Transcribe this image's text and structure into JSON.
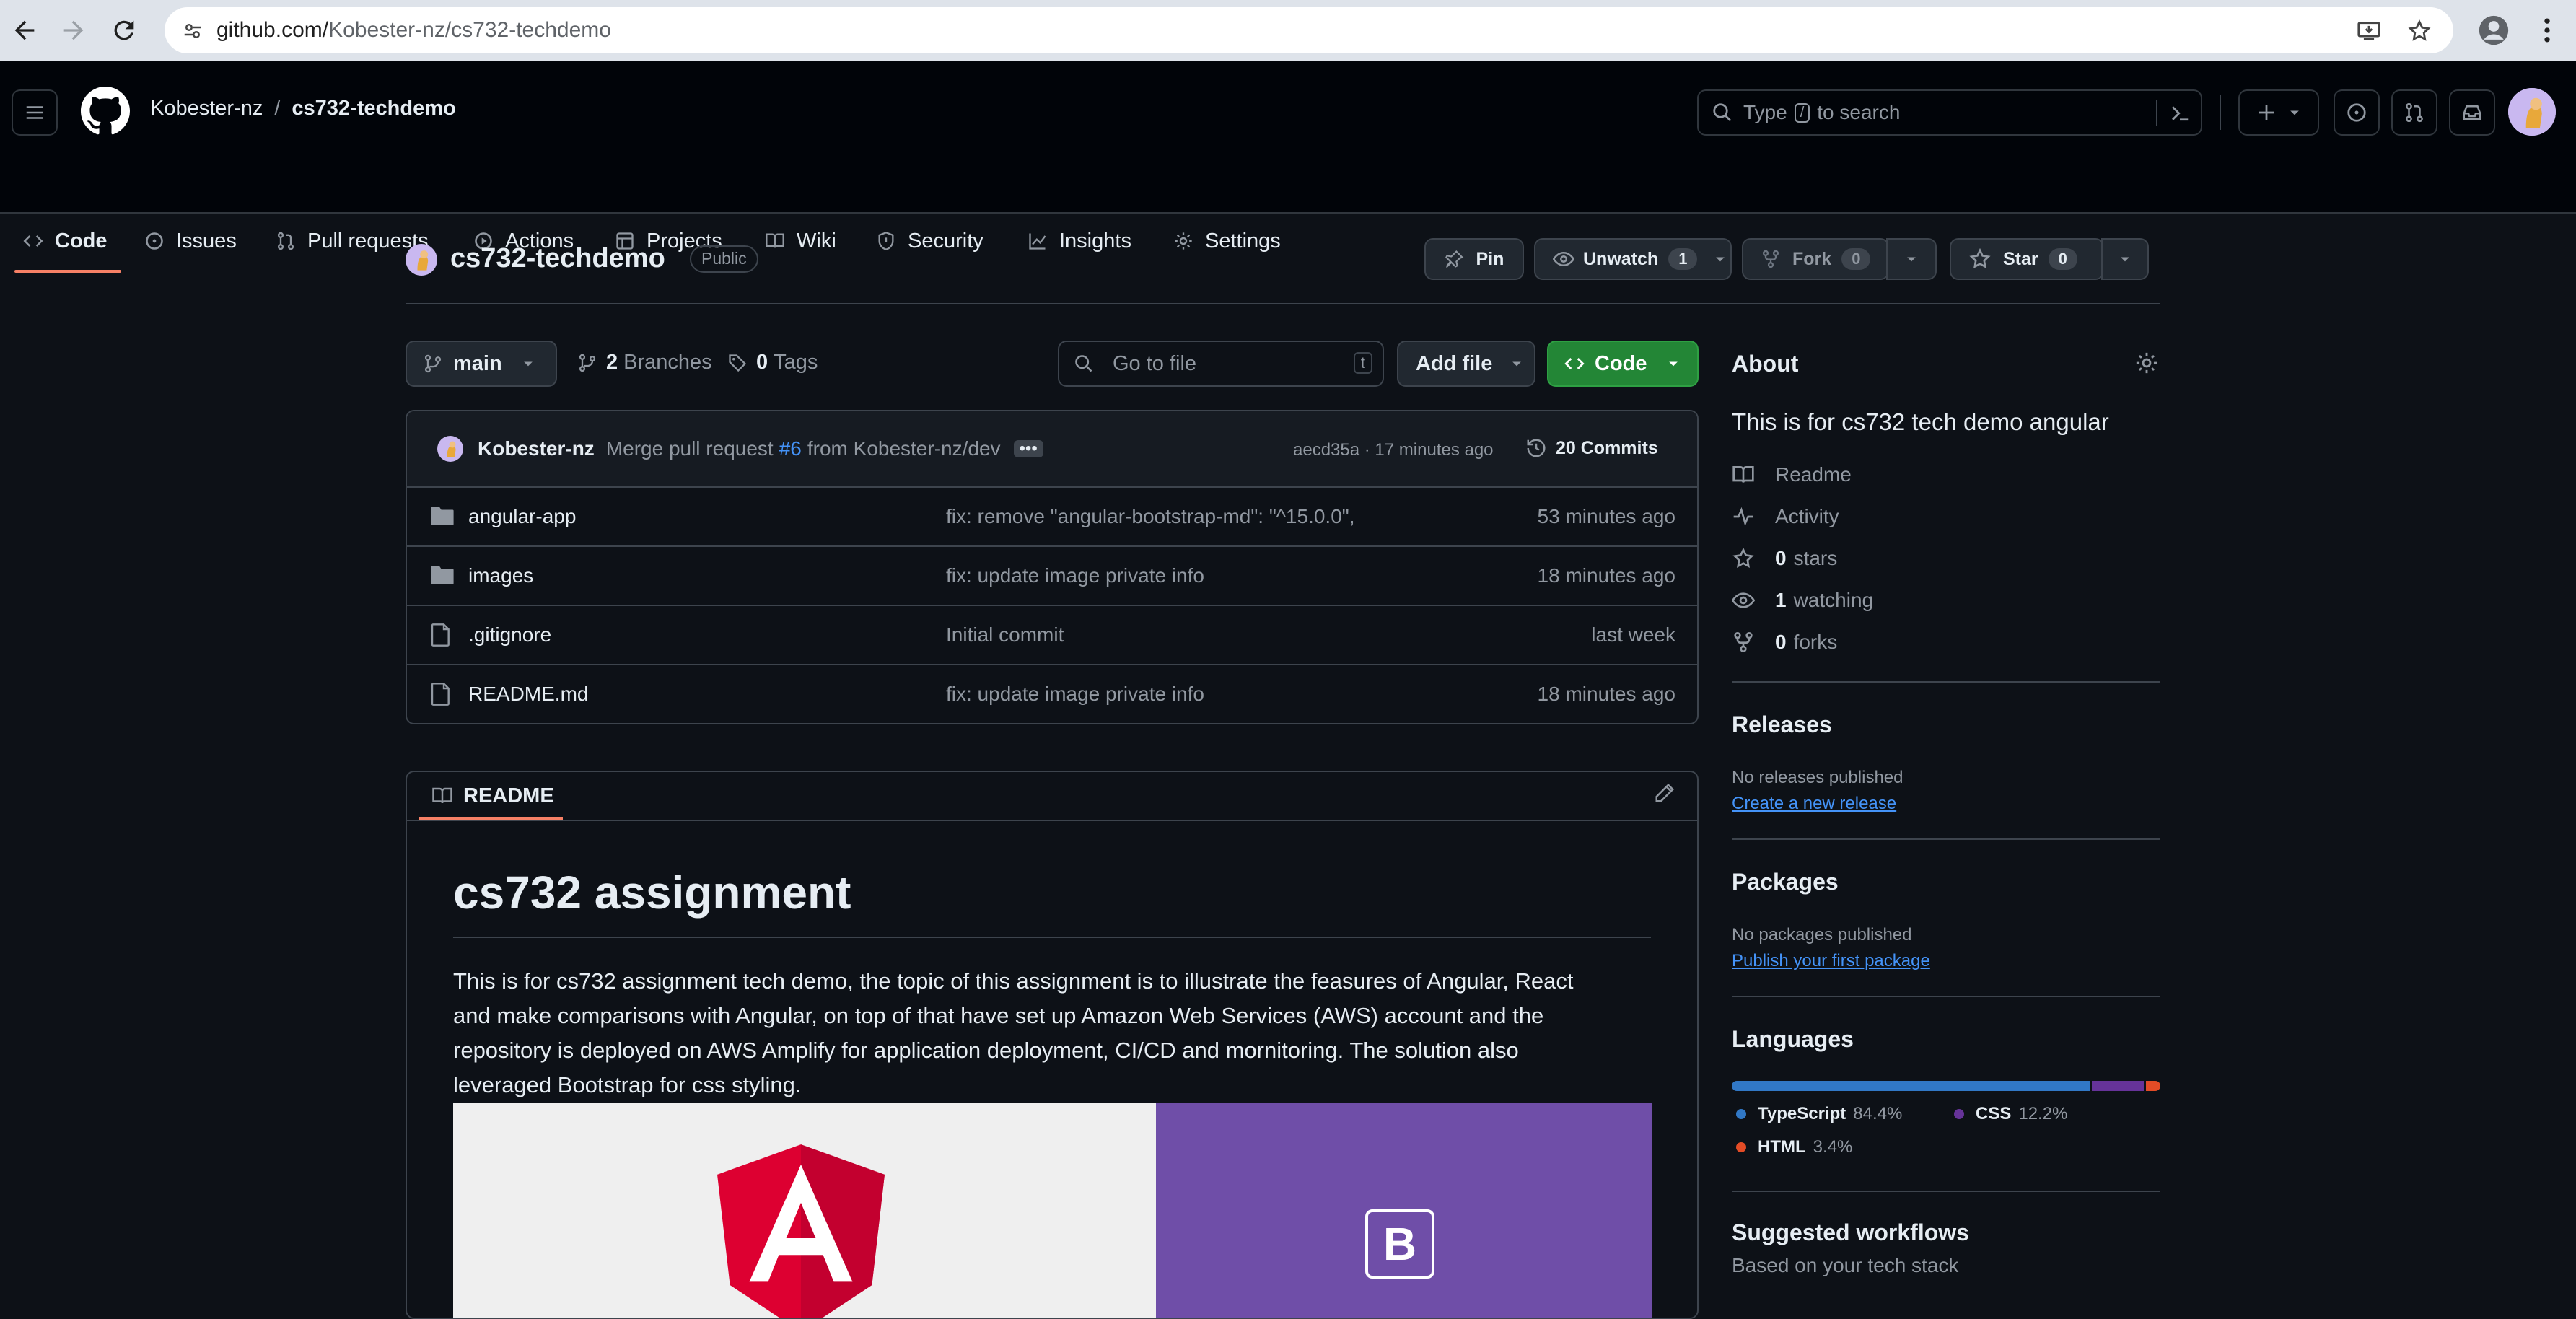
{
  "browser": {
    "url_host": "github.com/",
    "url_path": "Kobester-nz/cs732-techdemo"
  },
  "header": {
    "owner": "Kobester-nz",
    "sep": "/",
    "repo": "cs732-techdemo",
    "search_prefix": "Type",
    "search_key": "/",
    "search_suffix": "to search"
  },
  "nav": {
    "items": [
      "Code",
      "Issues",
      "Pull requests",
      "Actions",
      "Projects",
      "Wiki",
      "Security",
      "Insights",
      "Settings"
    ]
  },
  "repo": {
    "name": "cs732-techdemo",
    "visibility": "Public",
    "pin_label": "Pin",
    "unwatch_label": "Unwatch",
    "watch_count": "1",
    "fork_label": "Fork",
    "fork_count": "0",
    "star_label": "Star",
    "star_count": "0"
  },
  "toolbar": {
    "branch": "main",
    "branches_count": "2",
    "branches_label": "Branches",
    "tags_count": "0",
    "tags_label": "Tags",
    "goto_placeholder": "Go to file",
    "goto_key": "t",
    "add_file_label": "Add file",
    "code_label": "Code"
  },
  "commit": {
    "author": "Kobester-nz",
    "message_prefix": "Merge pull request",
    "pr_link": "#6",
    "message_suffix": "from Kobester-nz/dev",
    "hash_time": "aecd35a · 17 minutes ago",
    "commits_label": "20 Commits"
  },
  "files": [
    {
      "name": "angular-app",
      "type": "folder",
      "message": "fix: remove \"angular-bootstrap-md\": \"^15.0.0\",",
      "time": "53 minutes ago"
    },
    {
      "name": "images",
      "type": "folder",
      "message": "fix: update image private info",
      "time": "18 minutes ago"
    },
    {
      "name": ".gitignore",
      "type": "file",
      "message": "Initial commit",
      "time": "last week"
    },
    {
      "name": "README.md",
      "type": "file",
      "message": "fix: update image private info",
      "time": "18 minutes ago"
    }
  ],
  "readme": {
    "tab_label": "README",
    "heading": "cs732 assignment",
    "lines": [
      "This is for cs732 assignment tech demo, the topic of this assignment is to illustrate the feasures of Angular, React",
      "and make comparisons with Angular, on top of that have set up Amazon Web Services (AWS) account and the",
      "repository is deployed on AWS Amplify for application deployment, CI/CD and mornitoring. The solution also",
      "leveraged Bootstrap for css styling."
    ],
    "bootstrap_letter": "B",
    "angular_letter": "A"
  },
  "about": {
    "title": "About",
    "description": "This is for cs732 tech demo angular",
    "links": [
      {
        "icon": "book-icon",
        "label": "Readme",
        "bold": ""
      },
      {
        "icon": "pulse-icon",
        "label": "Activity",
        "bold": ""
      },
      {
        "icon": "star-icon",
        "label": "stars",
        "bold": "0"
      },
      {
        "icon": "eye-icon",
        "label": "watching",
        "bold": "1"
      },
      {
        "icon": "fork-icon",
        "label": "forks",
        "bold": "0"
      }
    ]
  },
  "releases": {
    "title": "Releases",
    "empty": "No releases published",
    "link": "Create a new release"
  },
  "packages": {
    "title": "Packages",
    "empty": "No packages published",
    "link": "Publish your first package"
  },
  "languages": {
    "title": "Languages",
    "items": [
      {
        "name": "TypeScript",
        "pct": "84.4%",
        "value": 84.4,
        "color": "#3178c6"
      },
      {
        "name": "CSS",
        "pct": "12.2%",
        "value": 12.2,
        "color": "#663399"
      },
      {
        "name": "HTML",
        "pct": "3.4%",
        "value": 3.4,
        "color": "#e34c26"
      }
    ]
  },
  "workflows": {
    "title": "Suggested workflows",
    "subtitle": "Based on your tech stack"
  },
  "colors": {
    "accent": "#f78166",
    "link": "#4493f8",
    "green_button": "#238636"
  }
}
